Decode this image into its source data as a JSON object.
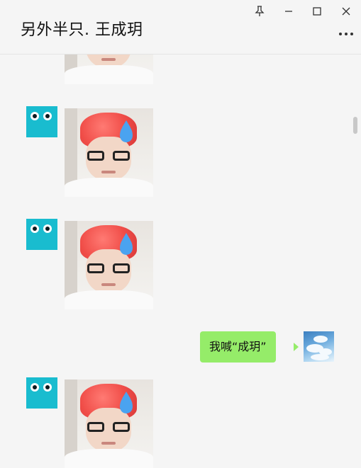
{
  "header": {
    "title": "另外半只. 王成玥"
  },
  "window_controls": {
    "pin_icon": "pin-icon",
    "minimize_icon": "minimize-icon",
    "maximize_icon": "maximize-icon",
    "close_icon": "close-icon",
    "more_icon": "more-options-icon"
  },
  "messages": [
    {
      "sender": "other",
      "type": "sticker"
    },
    {
      "sender": "other",
      "type": "sticker"
    },
    {
      "sender": "other",
      "type": "sticker"
    },
    {
      "sender": "me",
      "type": "text",
      "text": "我喊“成玥”"
    },
    {
      "sender": "other",
      "type": "sticker"
    }
  ],
  "colors": {
    "window_bg": "#f5f5f5",
    "my_bubble": "#95ec69",
    "other_avatar": "#19bccf",
    "hair": "#f04d48",
    "sweat_drop": "#4aa3f0"
  }
}
